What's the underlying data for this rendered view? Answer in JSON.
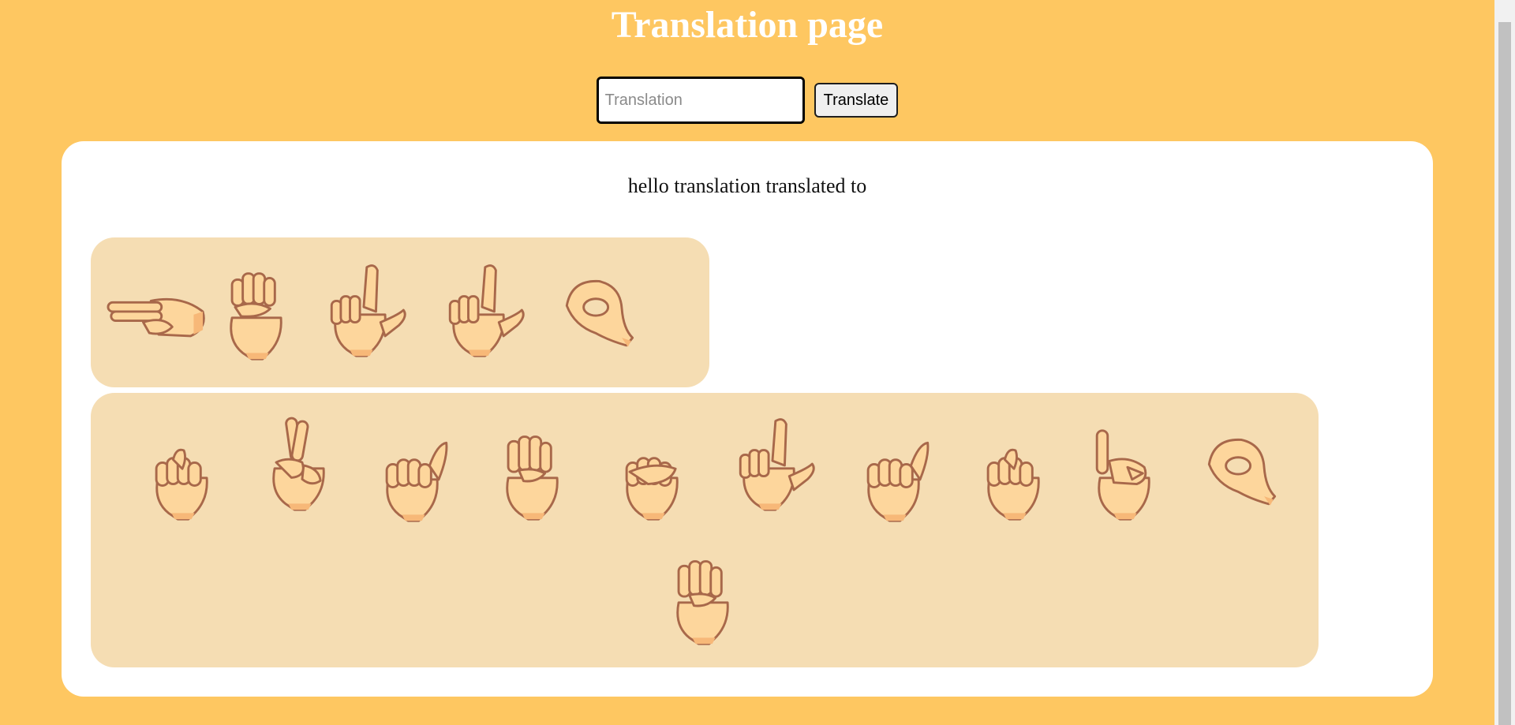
{
  "page": {
    "title": "Translation page"
  },
  "search": {
    "placeholder": "Translation",
    "value": "",
    "button_label": "Translate"
  },
  "result": {
    "text": "hello translation translated to"
  },
  "words": [
    {
      "word": "hello",
      "signs": [
        "sign-h-icon",
        "sign-e-icon",
        "sign-l-icon",
        "sign-l-icon",
        "sign-o-icon"
      ]
    },
    {
      "word": "translation",
      "signs": [
        "sign-t-icon",
        "sign-r-icon",
        "sign-a-icon",
        "sign-n-icon",
        "sign-s-icon",
        "sign-l-icon",
        "sign-a-icon",
        "sign-t-icon",
        "sign-i-icon",
        "sign-o-icon",
        "sign-n-icon"
      ]
    }
  ],
  "colors": {
    "background": "#fec761",
    "card": "#ffffff",
    "word_box": "#f5ddb3",
    "skin": "#fdd69c",
    "skin_shadow": "#f7b878",
    "skin_outline": "#a8684a"
  }
}
